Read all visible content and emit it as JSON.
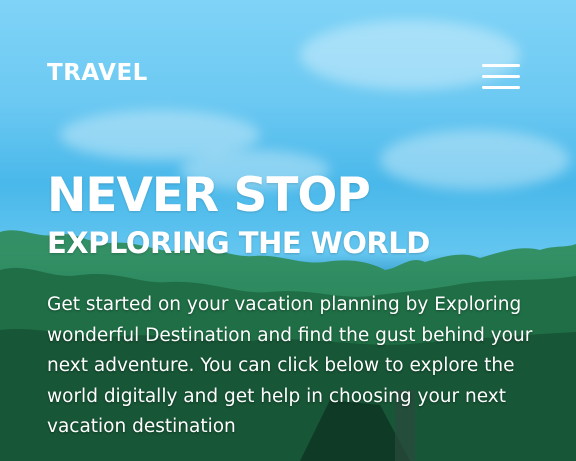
{
  "nav": {
    "logo": "TRAVEL",
    "menu_icon": "hamburger-menu-icon"
  },
  "hero": {
    "headline": "NEVER STOP",
    "subheadline": "EXPLORING THE WORLD",
    "description": "Get started on your vacation planning by Exploring wonderful Destination and find the gust behind your next adventure. You can click below to explore the world digitally and get help in choosing your next vacation destination"
  },
  "colors": {
    "sky": "#6cc9f2",
    "forest": "#1e6f58",
    "text": "#ffffff"
  }
}
